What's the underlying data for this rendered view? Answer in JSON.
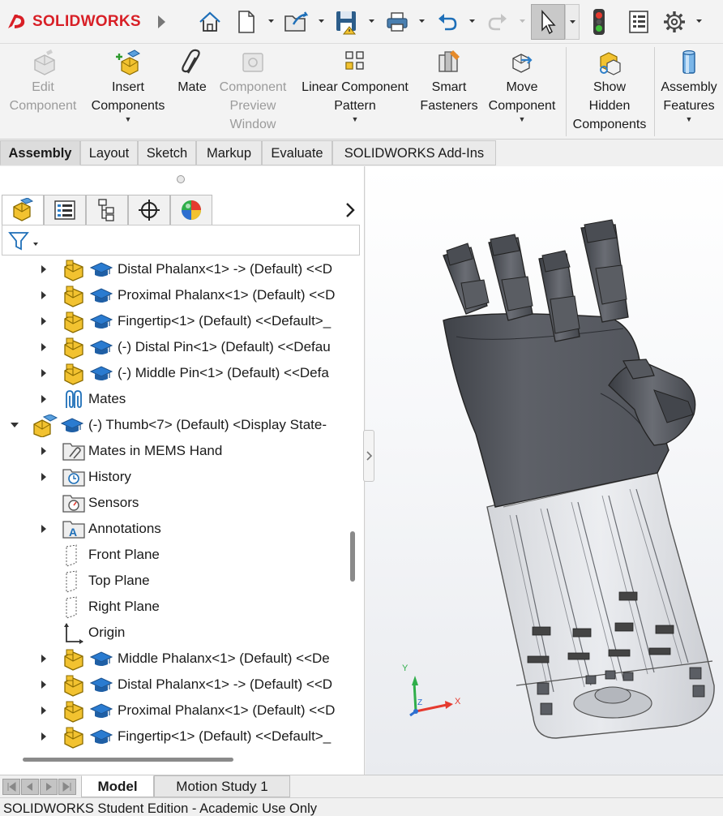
{
  "app": {
    "brand_prefix": "SOLID",
    "brand_suffix": "WORKS"
  },
  "quick_access": {
    "items": [
      "home-icon",
      "new-document-icon",
      "open-folder-icon",
      "save-icon",
      "print-icon",
      "undo-icon",
      "redo-icon",
      "select-arrow-icon",
      "rebuild-traffic-light-icon",
      "file-properties-icon",
      "options-gear-icon"
    ]
  },
  "command_manager": {
    "edit_component": "Edit\nComponent",
    "insert_components": "Insert\nComponents",
    "mate": "Mate",
    "component_preview": "Component\nPreview\nWindow",
    "linear_component_pattern": "Linear Component\nPattern",
    "smart_fasteners": "Smart\nFasteners",
    "move_component": "Move\nComponent",
    "show_hidden": "Show\nHidden\nComponents",
    "assembly_features": "Assembly\nFeatures"
  },
  "tabs": [
    "Assembly",
    "Layout",
    "Sketch",
    "Markup",
    "Evaluate",
    "SOLIDWORKS Add-Ins"
  ],
  "tree": {
    "rows": [
      {
        "label": "Distal Phalanx<1> -> (Default) <<D"
      },
      {
        "label": "Proximal Phalanx<1> (Default) <<D"
      },
      {
        "label": "Fingertip<1> (Default) <<Default>_"
      },
      {
        "label": "(-) Distal Pin<1> (Default) <<Defau"
      },
      {
        "label": "(-) Middle Pin<1> (Default) <<Defa"
      },
      {
        "label": "Mates"
      },
      {
        "label": "(-) Thumb<7> (Default) <Display State-"
      },
      {
        "label": "Mates in MEMS Hand"
      },
      {
        "label": "History"
      },
      {
        "label": "Sensors"
      },
      {
        "label": "Annotations"
      },
      {
        "label": "Front Plane"
      },
      {
        "label": "Top Plane"
      },
      {
        "label": "Right Plane"
      },
      {
        "label": "Origin"
      },
      {
        "label": "Middle Phalanx<1> (Default) <<De"
      },
      {
        "label": "Distal Phalanx<1> -> (Default) <<D"
      },
      {
        "label": "Proximal Phalanx<1> (Default) <<D"
      },
      {
        "label": "Fingertip<1> (Default) <<Default>_"
      }
    ]
  },
  "triad": {
    "x": "X",
    "y": "Y",
    "z": "Z"
  },
  "bottom_tabs": [
    "Model",
    "Motion Study 1"
  ],
  "status": "SOLIDWORKS Student Edition - Academic Use Only",
  "colors": {
    "brand_red": "#d81f26",
    "part_yellow": "#f2c230",
    "hand_body": "#5c5f66",
    "hand_clear": "#c9ccd2"
  }
}
